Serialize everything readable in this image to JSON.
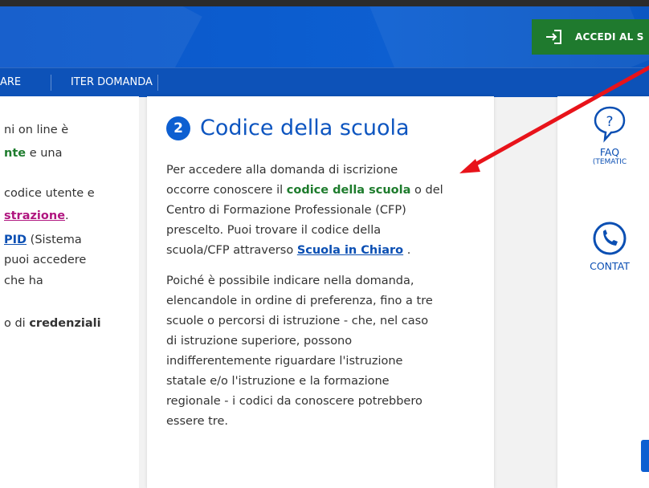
{
  "header": {
    "login_button": "ACCEDI AL S",
    "login_icon": "login-arrow-icon"
  },
  "nav": {
    "items": [
      "ARE",
      "ITER DOMANDA"
    ]
  },
  "left_column": {
    "lines": [
      {
        "a": "ni on line è",
        "b": "",
        "c": ""
      },
      {
        "a": "",
        "b": "nte",
        "c": " e una"
      },
      {
        "a": "codice utente e",
        "b": "",
        "c": ""
      },
      {
        "a": "",
        "b": "strazione",
        "c": "."
      },
      {
        "a": "",
        "b": "PID",
        "c": " (Sistema"
      },
      {
        "a": "puoi accedere",
        "b": "",
        "c": ""
      },
      {
        "a": " che ha",
        "b": "",
        "c": ""
      },
      {
        "a": "o di ",
        "b": "credenziali",
        "c": ""
      }
    ]
  },
  "main": {
    "step_number": "2",
    "title": "Codice della scuola",
    "para1": {
      "l1": "Per accedere alla domanda di iscrizione",
      "l2_pre": "occorre conoscere il ",
      "l2_bold": "codice della scuola",
      "l2_post": " o del",
      "l3": "Centro di Formazione Professionale (CFP)",
      "l4": "prescelto. Puoi trovare il codice della",
      "l5_pre": "scuola/CFP attraverso ",
      "l5_link": "Scuola in Chiaro",
      "l5_post": " ."
    },
    "para2": [
      "Poiché è possibile indicare nella domanda,",
      "elencandole in ordine di preferenza, fino a tre",
      "scuole o percorsi di istruzione - che, nel caso",
      "di istruzione superiore, possono",
      "indifferentemente riguardare l'istruzione",
      "statale e/o l'istruzione e la formazione",
      "regionale - i codici da conoscere potrebbero",
      "essere tre."
    ]
  },
  "right_column": {
    "faq_label": "FAQ",
    "faq_sub": "(TEMATIC",
    "contact_label": "CONTAT",
    "faq_icon": "question-bubble-icon",
    "contact_icon": "phone-icon"
  },
  "colors": {
    "header_blue": "#0d5fd1",
    "login_green": "#1f7a2e",
    "annotation_arrow": "#e8131a"
  }
}
